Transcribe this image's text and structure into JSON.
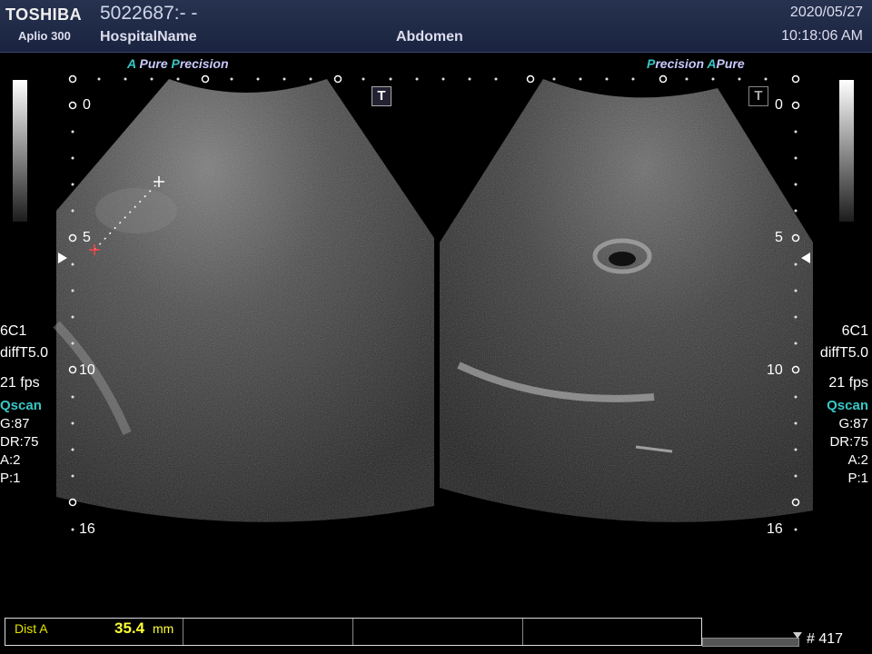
{
  "header": {
    "brand": "TOSHIBA",
    "model": "Aplio 300",
    "patient_id": "5022687:- -",
    "hospital": "HospitalName",
    "preset": "Abdomen",
    "date": "2020/05/27",
    "time": "10:18:06 AM"
  },
  "left_image": {
    "label_a": "A",
    "label_pure": "Pure",
    "label_p": "P",
    "label_recision": "recision",
    "depth_labels": [
      "0",
      "5",
      "10",
      "16"
    ],
    "params": [
      "6C1",
      "diffT5.0",
      "21 fps",
      "Qscan",
      "G:87",
      "DR:75",
      "A:2",
      "P:1"
    ],
    "t_marker": "T"
  },
  "right_image": {
    "label_p": "P",
    "label_recision": "recision",
    "label_a": "A",
    "label_pure": "Pure",
    "depth_labels": [
      "0",
      "5",
      "10",
      "16"
    ],
    "params": [
      "6C1",
      "diffT5.0",
      "21 fps",
      "Qscan",
      "G:87",
      "DR:75",
      "A:2",
      "P:1"
    ],
    "t_marker": "T"
  },
  "measurement": {
    "label": "Dist A",
    "value": "35.4",
    "unit": "mm"
  },
  "cine": {
    "frame": "# 417"
  }
}
